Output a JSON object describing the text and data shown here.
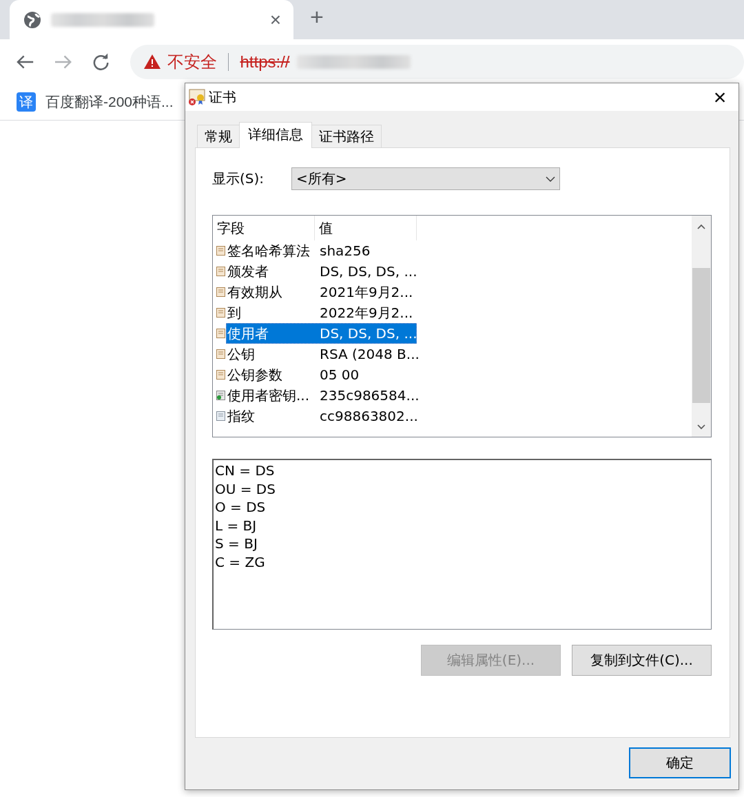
{
  "browser": {
    "tab": {
      "close": "×"
    },
    "new_tab": "+",
    "address": {
      "warning": "不安全",
      "scheme": "https://"
    },
    "bookmarks": [
      {
        "badge": "译",
        "label": "百度翻译-200种语..."
      }
    ]
  },
  "dialog": {
    "title": "证书",
    "close": "×",
    "tabs": [
      {
        "label": "常规",
        "selected": false
      },
      {
        "label": "详细信息",
        "selected": true
      },
      {
        "label": "证书路径",
        "selected": false
      }
    ],
    "show": {
      "label": "显示(S):",
      "value": "<所有>"
    },
    "columns": [
      "字段",
      "值"
    ],
    "rows": [
      {
        "kind": "field",
        "field": "签名哈希算法",
        "value": "sha256",
        "selected": false
      },
      {
        "kind": "field",
        "field": "颁发者",
        "value": "DS, DS, DS, ...",
        "selected": false
      },
      {
        "kind": "field",
        "field": "有效期从",
        "value": "2021年9月2...",
        "selected": false
      },
      {
        "kind": "field",
        "field": "到",
        "value": "2022年9月2...",
        "selected": false
      },
      {
        "kind": "field",
        "field": "使用者",
        "value": "DS, DS, DS, ...",
        "selected": true
      },
      {
        "kind": "field",
        "field": "公钥",
        "value": "RSA (2048 B...",
        "selected": false
      },
      {
        "kind": "field",
        "field": "公钥参数",
        "value": "05 00",
        "selected": false
      },
      {
        "kind": "extension",
        "field": "使用者密钥...",
        "value": "235c986584...",
        "selected": false
      },
      {
        "kind": "property",
        "field": "指纹",
        "value": "cc98863802...",
        "selected": false
      }
    ],
    "details": [
      "CN = DS",
      "OU = DS",
      "O = DS",
      "L = BJ",
      "S = BJ",
      "C = ZG"
    ],
    "buttons": [
      {
        "label": "编辑属性(E)...",
        "disabled": true
      },
      {
        "label": "复制到文件(C)...",
        "disabled": false
      }
    ],
    "ok": "确定"
  }
}
